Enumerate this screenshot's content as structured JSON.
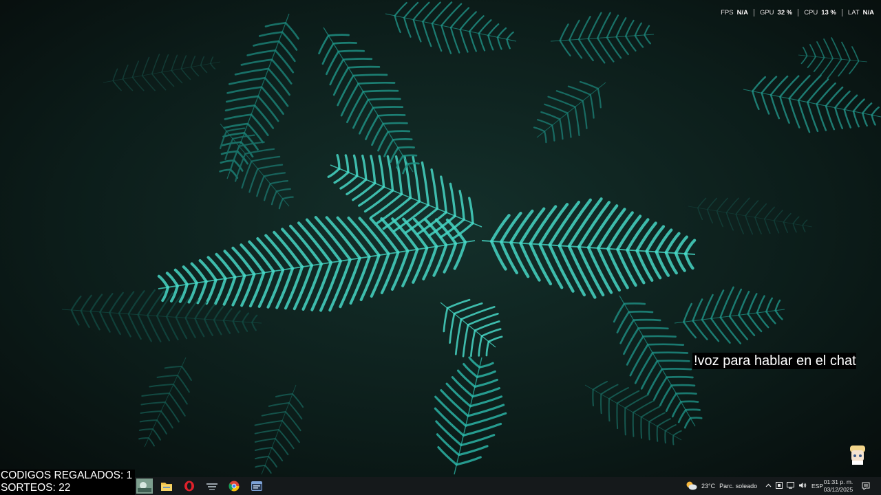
{
  "perf_overlay": [
    {
      "label": "FPS",
      "value": "N/A"
    },
    {
      "label": "GPU",
      "value": "32 %"
    },
    {
      "label": "CPU",
      "value": "13 %"
    },
    {
      "label": "LAT",
      "value": "N/A"
    }
  ],
  "chat_command": "!voz para hablar en el chat",
  "stream_overlay": {
    "codes_line": "CODIGOS REGALADOS: 1",
    "raffles_line": "SORTEOS: 22"
  },
  "taskbar": {
    "pinned_icons": [
      "app-thumbnail-icon",
      "file-explorer-icon",
      "opera-icon",
      "launcher-icon",
      "chrome-icon",
      "app-window-icon"
    ],
    "weather": {
      "temp": "23°C",
      "condition": "Parc. soleado",
      "icon": "partly-sunny-icon"
    },
    "tray_icons": [
      "chevron-up-icon",
      "security-icon",
      "network-icon",
      "volume-icon"
    ],
    "language": "ESP",
    "time": "01:31 p. m.",
    "date": "03/12/2025",
    "notification_icon": "notification-icon"
  },
  "colors": {
    "fern": "#2aa79a",
    "fern_bright": "#46d6c4",
    "background": "#0a1512",
    "taskbar": "#15191b"
  }
}
